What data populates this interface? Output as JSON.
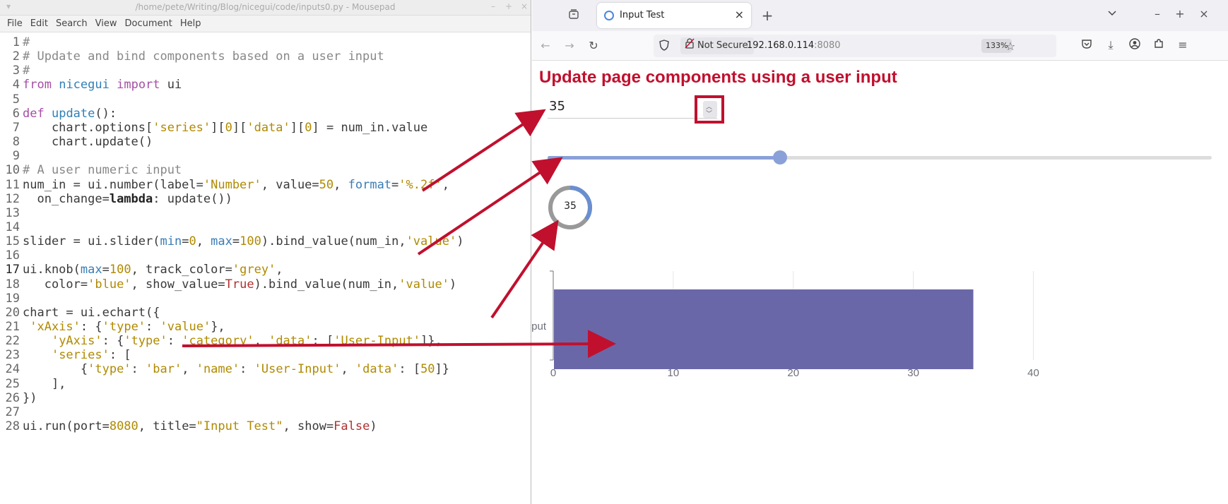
{
  "editor": {
    "title": "/home/pete/Writing/Blog/nicegui/code/inputs0.py - Mousepad",
    "menu": [
      "File",
      "Edit",
      "Search",
      "View",
      "Document",
      "Help"
    ],
    "line_numbers": [
      "1",
      "2",
      "3",
      "4",
      "5",
      "6",
      "7",
      "8",
      "9",
      "10",
      "11",
      "12",
      "13",
      "14",
      "15",
      "16",
      "17",
      "18",
      "19",
      "20",
      "21",
      "22",
      "23",
      "24",
      "25",
      "26",
      "27",
      "28"
    ],
    "lines": [
      "#",
      "# Update and bind components based on a user input",
      "#",
      "from nicegui import ui",
      "",
      "def update():",
      "    chart.options['series'][0]['data'][0] = num_in.value",
      "    chart.update()",
      "",
      "# A user numeric input",
      "num_in = ui.number(label='Number', value=50, format='%.2f',",
      "  on_change=lambda: update())",
      "",
      "",
      "slider = ui.slider(min=0, max=100).bind_value(num_in,'value')",
      "",
      "ui.knob(max=100, track_color='grey',",
      "   color='blue', show_value=True).bind_value(num_in,'value')",
      "",
      "chart = ui.echart({",
      " 'xAxis': {'type': 'value'},",
      "    'yAxis': {'type': 'category', 'data': ['User-Input']},",
      "    'series': [",
      "        {'type': 'bar', 'name': 'User-Input', 'data': [50]}",
      "    ],",
      "})",
      "",
      "ui.run(port=8080, title=\"Input Test\", show=False)"
    ]
  },
  "browser": {
    "tab_title": "Input Test",
    "not_secure": "Not Secure",
    "url_host": "192.168.0.114",
    "url_port": ":8080",
    "zoom": "133%",
    "icons": [
      "back-icon",
      "forward-icon",
      "reload-icon",
      "shield-icon",
      "lock-broken-icon",
      "star-icon",
      "pocket-icon",
      "download-icon",
      "account-icon",
      "extensions-icon",
      "menu-icon",
      "tab-list-icon",
      "new-tab-icon",
      "minimize-icon",
      "maximize-icon",
      "close-icon"
    ]
  },
  "page": {
    "heading": "Update page components using a user input",
    "number_value": "35",
    "slider_value": 35,
    "knob_value": "35",
    "knob_fraction": 0.35
  },
  "chart_data": {
    "type": "bar",
    "orientation": "horizontal",
    "categories": [
      "User-Input"
    ],
    "values": [
      35
    ],
    "xlim": [
      0,
      45
    ],
    "xticks": [
      "0",
      "10",
      "20",
      "30",
      "40"
    ],
    "bar_color": "#6a67a8",
    "grid": true
  },
  "colors": {
    "accent": "#c0102e",
    "slider": "#8aa0d8",
    "knob": "#6a8fd0",
    "knob_track": "#999999"
  }
}
